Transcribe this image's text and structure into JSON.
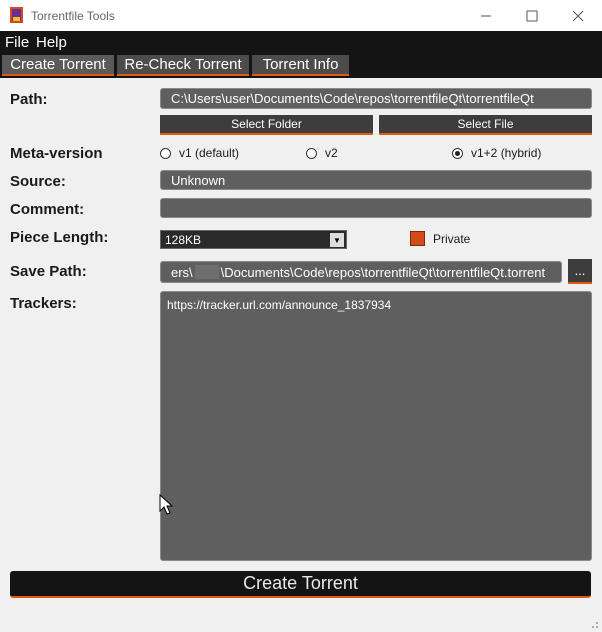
{
  "window": {
    "title": "Torrentfile Tools"
  },
  "menu": {
    "file": "File",
    "help": "Help"
  },
  "tabs": [
    {
      "label": "Create Torrent",
      "active": true
    },
    {
      "label": "Re-Check Torrent",
      "active": false
    },
    {
      "label": "Torrent Info",
      "active": false
    }
  ],
  "form": {
    "path_label": "Path:",
    "path_value": "C:\\Users\\user\\Documents\\Code\\repos\\torrentfileQt\\torrentfileQt",
    "select_folder": "Select Folder",
    "select_file": "Select File",
    "meta_label": "Meta-version",
    "meta_options": [
      "v1 (default)",
      "v2",
      "v1+2 (hybrid)"
    ],
    "meta_selected": "v1+2 (hybrid)",
    "source_label": "Source:",
    "source_value": "Unknown",
    "comment_label": "Comment:",
    "comment_value": "",
    "piece_label": "Piece Length:",
    "piece_value": "128KB",
    "private_label": "Private",
    "save_label": "Save Path:",
    "save_value_prefix": "ers\\",
    "save_value": "\\Documents\\Code\\repos\\torrentfileQt\\torrentfileQt.torrent",
    "browse_label": "...",
    "trackers_label": "Trackers:",
    "trackers_value": "https://tracker.url.com/announce_1837934",
    "create_button": "Create Torrent"
  },
  "colors": {
    "accent": "#e15a14",
    "field_bg": "#5f5f5f",
    "menubar_bg": "#141414"
  }
}
